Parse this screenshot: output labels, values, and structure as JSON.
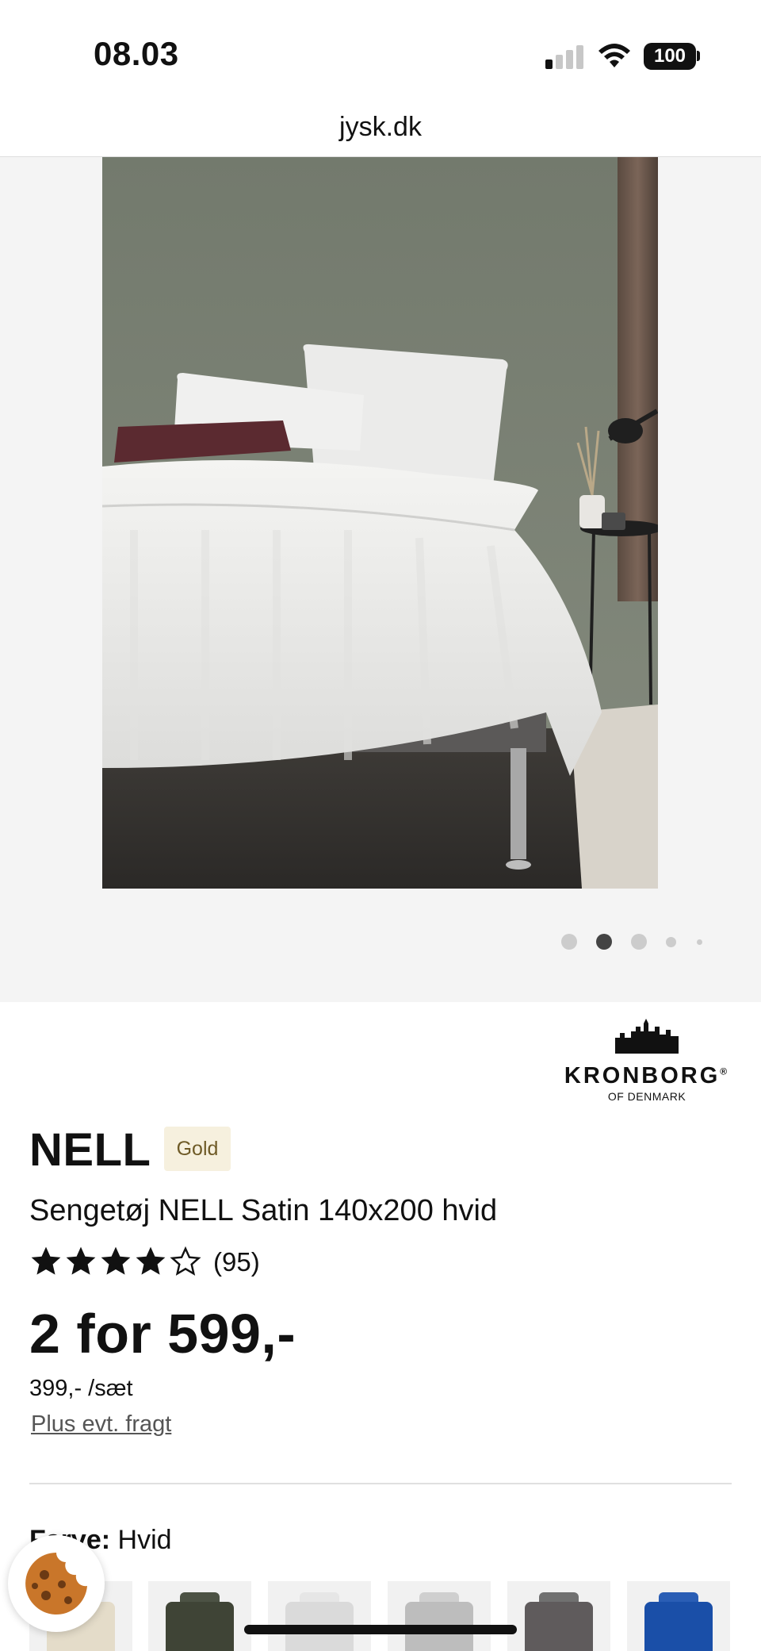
{
  "status_bar": {
    "time": "08.03",
    "battery": "100"
  },
  "browser": {
    "url": "jysk.dk"
  },
  "gallery": {
    "dot_count": 5,
    "active_index": 1
  },
  "brand": {
    "name": "KRONBORG",
    "registered_mark": "®",
    "subtitle": "OF DENMARK"
  },
  "product": {
    "title": "NELL",
    "badge": "Gold",
    "subtitle": "Sengetøj NELL Satin 140x200 hvid",
    "rating": {
      "stars_filled": 4,
      "stars_total": 5,
      "count": "(95)"
    },
    "price": "2 for 599,-",
    "unit_price": "399,- /sæt",
    "shipping_link": "Plus evt. fragt"
  },
  "color": {
    "label": "Farve:",
    "value": "Hvid",
    "swatches": [
      {
        "name": "sand",
        "color": "#e4dcc9"
      },
      {
        "name": "dark-green",
        "color": "#3f4436"
      },
      {
        "name": "light-grey",
        "color": "#dadada"
      },
      {
        "name": "grey",
        "color": "#bdbdbd"
      },
      {
        "name": "dark-grey",
        "color": "#5f5b5c"
      },
      {
        "name": "blue",
        "color": "#1a4fa8"
      }
    ]
  },
  "colors": {
    "badge_bg": "#f6f0de",
    "badge_text": "#6e5a26",
    "cookie": "#c9762a"
  }
}
